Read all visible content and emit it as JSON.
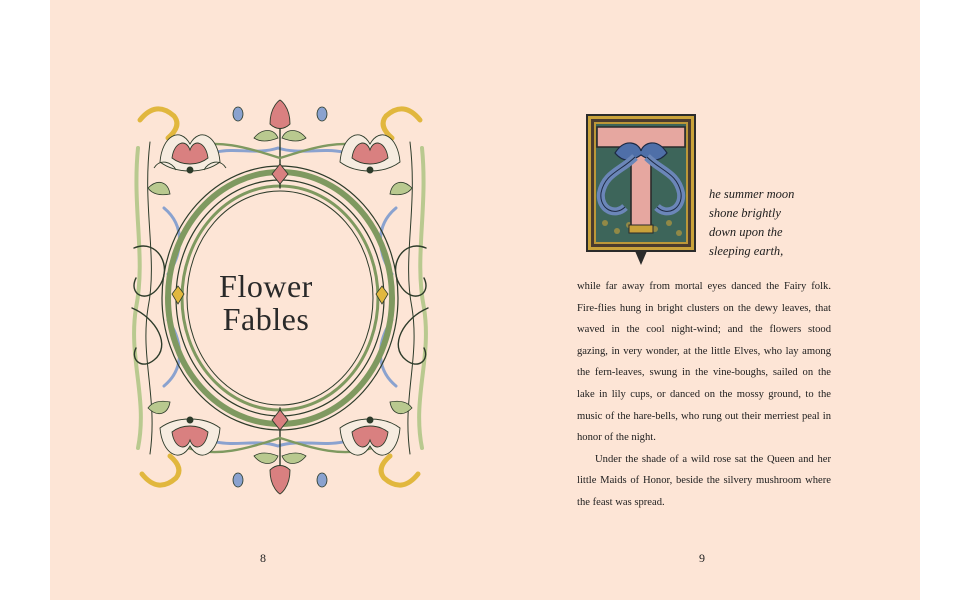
{
  "book": {
    "title_line1": "Flower",
    "title_line2": "Fables"
  },
  "left_page": {
    "page_number": "8",
    "frame": "art-nouveau-floral-frame"
  },
  "right_page": {
    "page_number": "9",
    "drop_cap_letter": "T",
    "opening_lines": [
      "he summer moon",
      "shone brightly",
      "down upon the",
      "sleeping earth,"
    ],
    "paragraphs": [
      "while far away from mortal eyes danced the Fairy folk. Fire-flies hung in bright clusters on the dewy leaves, that waved in the cool night-wind; and the flowers stood gazing, in very wonder, at the little Elves, who lay among the fern-leaves, swung in the vine-boughs, sailed on the lake in lily cups, or danced on the mossy ground, to the music of the hare-bells, who rung out their merriest peal in honor of the night.",
      "Under the shade of a wild rose sat the Queen and her little Maids of Honor, beside the silvery mushroom where the feast was spread."
    ]
  },
  "colors": {
    "paper": "#fde5d6",
    "frame_green": "#7f9960",
    "frame_blue": "#6b86b8",
    "petal_pink": "#d98080",
    "dropcap_blue": "#4f6fa8",
    "dropcap_gold": "#c9a23a"
  }
}
